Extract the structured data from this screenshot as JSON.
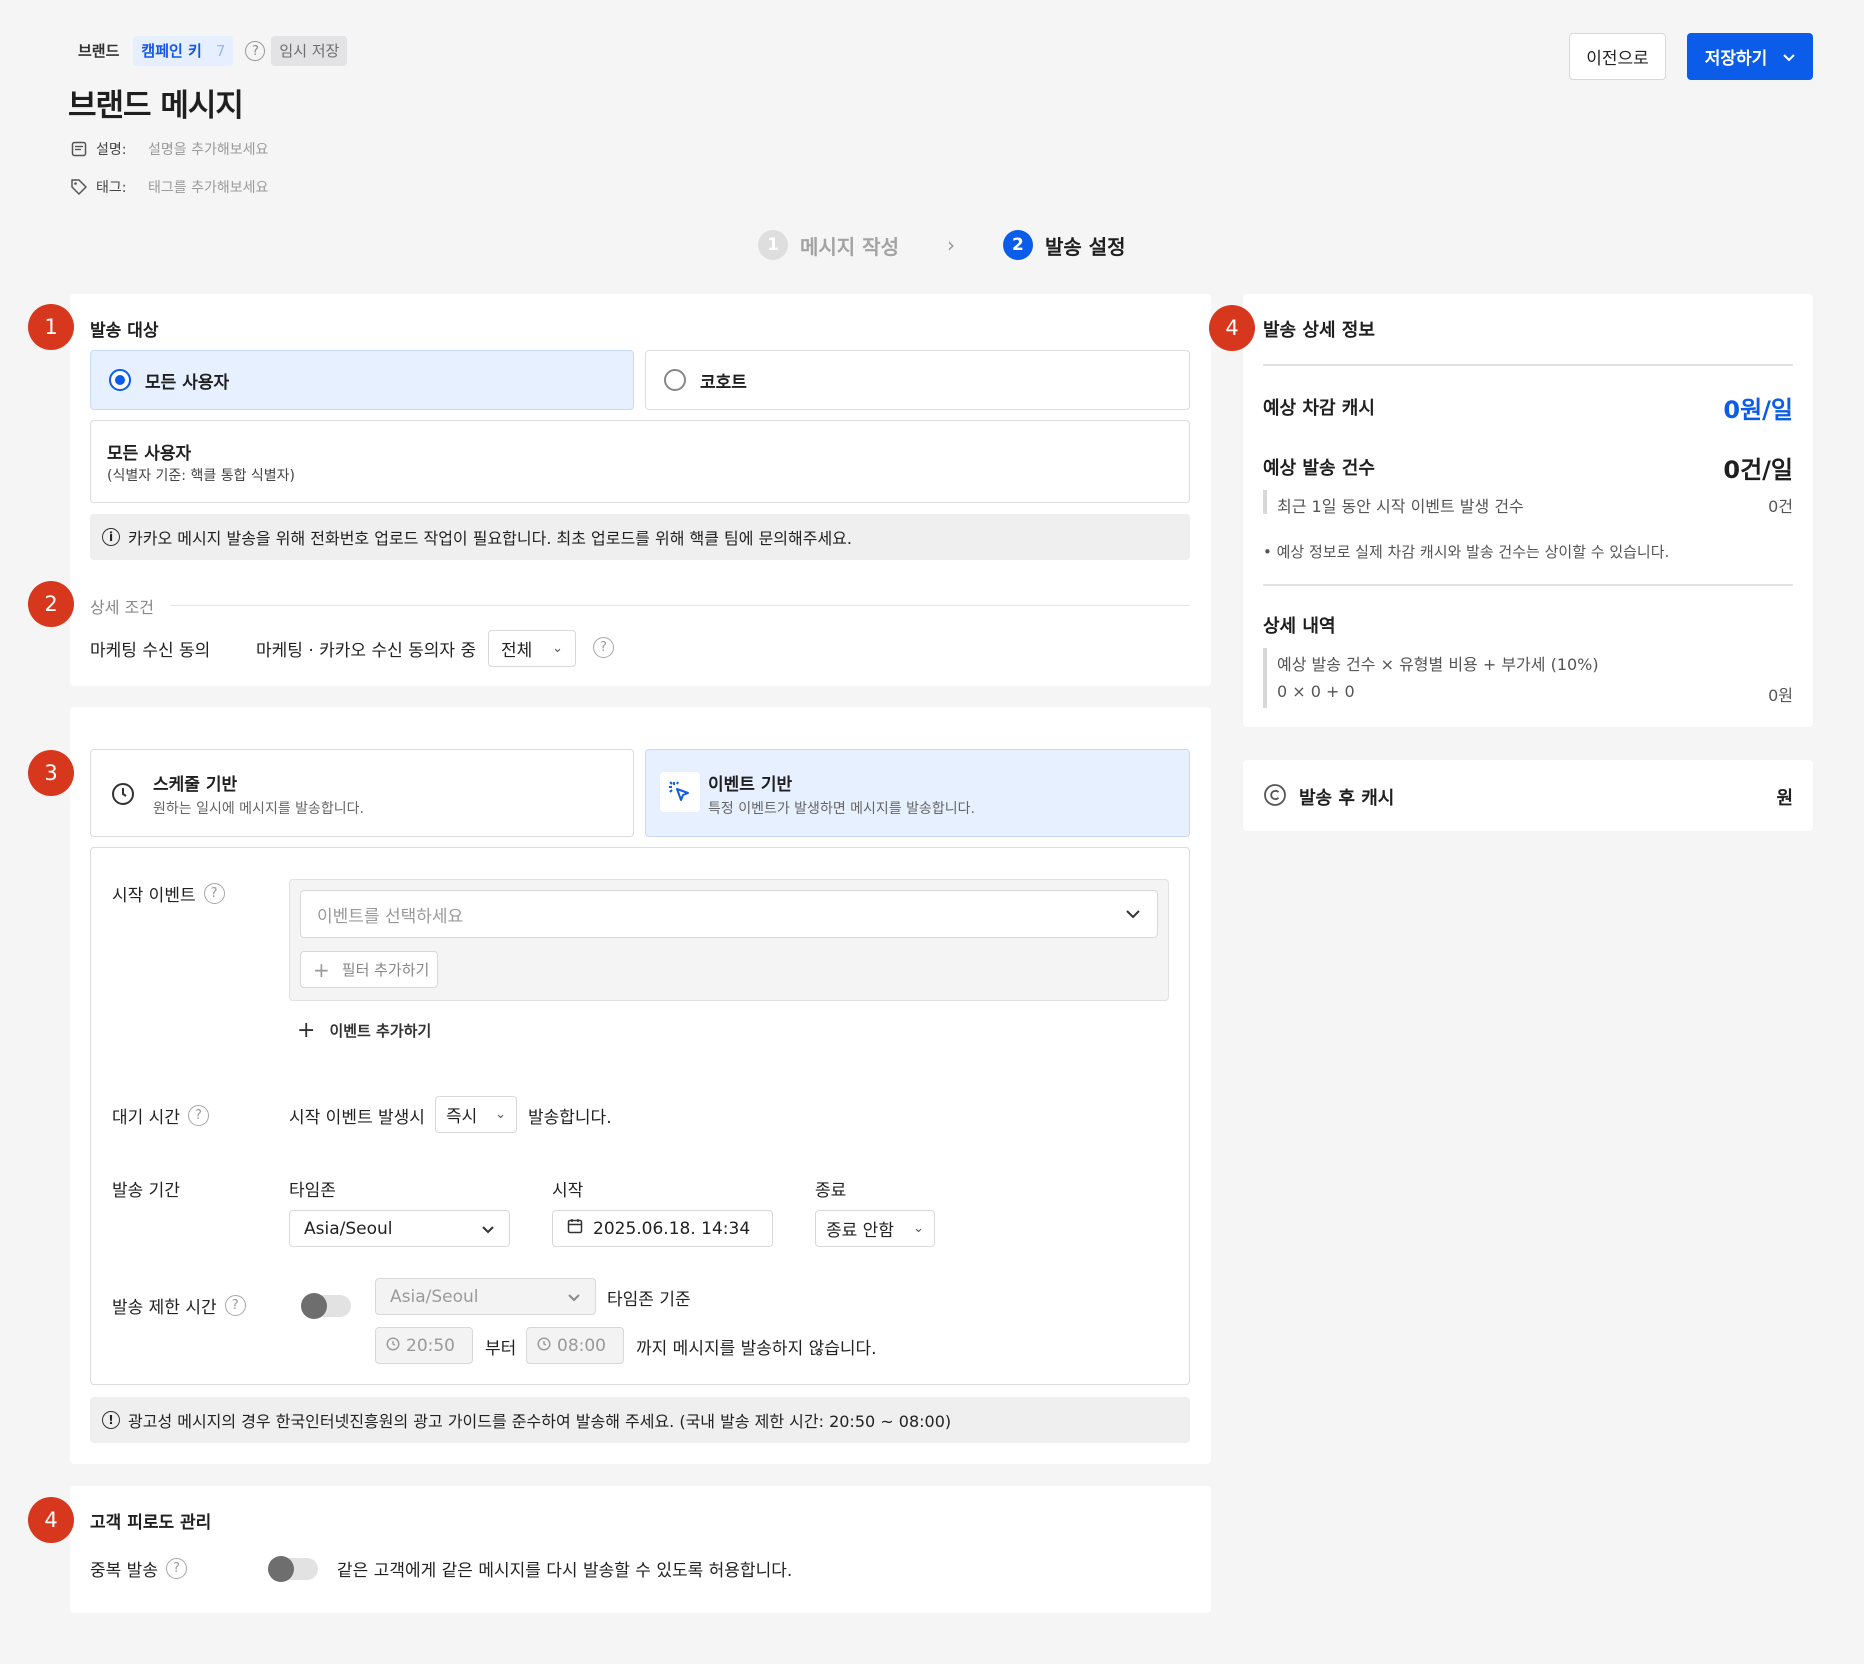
{
  "header": {
    "crumb_brand": "브랜드",
    "crumb_key_label": "캠페인 키",
    "crumb_key_value": "7",
    "crumb_help": "?",
    "crumb_draft": "임시 저장",
    "title": "브랜드 메시지",
    "desc_label": "설명:",
    "desc_placeholder": "설명을 추가해보세요",
    "tag_label": "태그:",
    "tag_placeholder": "태그를 추가해보세요",
    "prev_button": "이전으로",
    "save_button": "저장하기"
  },
  "steps": [
    {
      "num": "1",
      "label": "메시지 작성"
    },
    {
      "num": "2",
      "label": "발송 설정"
    }
  ],
  "badges": [
    "1",
    "2",
    "3",
    "4",
    "4"
  ],
  "target": {
    "title": "발송 대상",
    "option_all": "모든 사용자",
    "option_cohort": "코호트",
    "summary_title": "모든 사용자",
    "summary_sub": "(식별자 기준: 핵클 통합 식별자)",
    "notice": "카카오 메시지 발송을 위해 전화번호 업로드 작업이 필요합니다. 최초 업로드를 위해 핵클 팀에 문의해주세요."
  },
  "conditions": {
    "title": "상세 조건",
    "marketing_label": "마케팅 수신 동의",
    "marketing_desc": "마케팅 · 카카오 수신 동의자 중",
    "marketing_select": "전체"
  },
  "trigger": {
    "schedule_title": "스케줄 기반",
    "schedule_sub": "원하는 일시에 메시지를 발송합니다.",
    "event_title": "이벤트 기반",
    "event_sub": "특정 이벤트가 발생하면 메시지를 발송합니다.",
    "start_event_label": "시작 이벤트",
    "event_placeholder": "이벤트를 선택하세요",
    "add_filter": "필터 추가하기",
    "add_event": "이벤트 추가하기",
    "wait_label": "대기 시간",
    "wait_prefix": "시작 이벤트 발생시",
    "wait_select": "즉시",
    "wait_suffix": "발송합니다.",
    "period_label": "발송 기간",
    "timezone_label": "타임존",
    "timezone_value": "Asia/Seoul",
    "start_label": "시작",
    "start_value": "2025.06.18. 14:34",
    "end_label": "종료",
    "end_value": "종료 안함",
    "limit_label": "발송 제한 시간",
    "limit_timezone": "Asia/Seoul",
    "limit_tz_suffix": "타임존 기준",
    "limit_from": "20:50",
    "limit_from_suffix": "부터",
    "limit_to": "08:00",
    "limit_to_suffix": "까지 메시지를 발송하지 않습니다.",
    "notice": "광고성 메시지의 경우 한국인터넷진흥원의 광고 가이드를 준수하여 발송해 주세요. (국내 발송 제한 시간: 20:50 ~ 08:00)"
  },
  "fatigue": {
    "title": "고객 피로도 관리",
    "dup_label": "중복 발송",
    "dup_desc": "같은 고객에게 같은 메시지를 다시 발송할 수 있도록 허용합니다."
  },
  "detail": {
    "title": "발송 상세 정보",
    "est_cash_label": "예상 차감 캐시",
    "est_cash_value": "0원/일",
    "est_count_label": "예상 발송 건수",
    "est_count_value": "0건/일",
    "recent_label": "최근 1일 동안 시작 이벤트 발생 건수",
    "recent_value": "0건",
    "note": "• 예상 정보로 실제 차감 캐시와 발송 건수는 상이할 수 있습니다.",
    "breakdown_title": "상세 내역",
    "formula": "예상 발송 건수 × 유형별 비용 + 부가세 (10%)",
    "formula_values": "0 × 0 + 0",
    "formula_result": "0원"
  },
  "after_cash": {
    "label": "발송 후 캐시",
    "value": "원"
  },
  "colors": {
    "accent": "#0b5ce8",
    "badge": "#d7371c",
    "background": "#f5f5f6"
  }
}
